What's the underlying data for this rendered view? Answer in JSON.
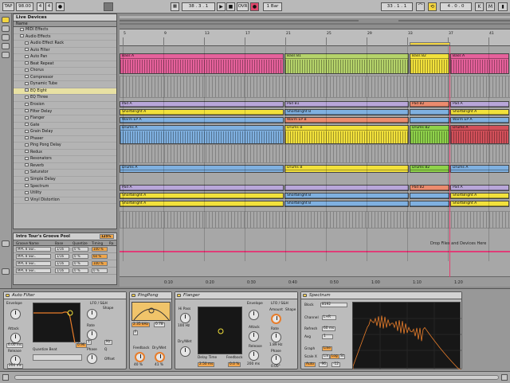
{
  "transport": {
    "tap": "TAP",
    "tempo": "98.00",
    "sig_num": "4",
    "sig_den": "4",
    "follow_icon": "metronome-icon",
    "position": "38 . 3 . 1",
    "ovr": "OVR",
    "quantize": "1 Bar",
    "loop_start": "33 . 1 . 1",
    "loop_len": "4 . 0 . 0"
  },
  "browser": {
    "title": "Live Devices",
    "column": "Name",
    "items": [
      {
        "label": "MIDI Effects",
        "depth": 1
      },
      {
        "label": "Audio Effects",
        "depth": 1
      },
      {
        "label": "Audio Effect Rack",
        "depth": 2
      },
      {
        "label": "Auto Filter",
        "depth": 2
      },
      {
        "label": "Auto Pan",
        "depth": 2
      },
      {
        "label": "Beat Repeat",
        "depth": 2
      },
      {
        "label": "Chorus",
        "depth": 2
      },
      {
        "label": "Compressor",
        "depth": 2
      },
      {
        "label": "Dynamic Tube",
        "depth": 2
      },
      {
        "label": "EQ Eight",
        "depth": 2,
        "selected": true
      },
      {
        "label": "EQ Three",
        "depth": 2
      },
      {
        "label": "Erosion",
        "depth": 2
      },
      {
        "label": "Filter Delay",
        "depth": 2
      },
      {
        "label": "Flanger",
        "depth": 2
      },
      {
        "label": "Gate",
        "depth": 2
      },
      {
        "label": "Grain Delay",
        "depth": 2
      },
      {
        "label": "Phaser",
        "depth": 2
      },
      {
        "label": "Ping Pong Delay",
        "depth": 2
      },
      {
        "label": "Redux",
        "depth": 2
      },
      {
        "label": "Resonators",
        "depth": 2
      },
      {
        "label": "Reverb",
        "depth": 2
      },
      {
        "label": "Saturator",
        "depth": 2
      },
      {
        "label": "Simple Delay",
        "depth": 2
      },
      {
        "label": "Spectrum",
        "depth": 2
      },
      {
        "label": "Utility",
        "depth": 2
      },
      {
        "label": "Vinyl Distortion",
        "depth": 2
      }
    ]
  },
  "groove": {
    "title": "Intro Tour's Groove Pool",
    "global": "125%",
    "columns": [
      "Groove Name",
      "Base",
      "Quantize",
      "Timing",
      "Ra"
    ],
    "rows": [
      {
        "name": "MPC 8 Swi..",
        "base": "1/16",
        "quantize": "0 %",
        "timing": "100 %"
      },
      {
        "name": "MPC 8 Swi..",
        "base": "1/16",
        "quantize": "0 %",
        "timing": "60 %"
      },
      {
        "name": "MPC 8 Swi..",
        "base": "1/16",
        "quantize": "0 %",
        "timing": "100 %"
      },
      {
        "name": "MPC 8 Swi..",
        "base": "1/16",
        "quantize": "0 %",
        "timing": "0 %"
      }
    ]
  },
  "arrangement": {
    "bars": [
      "5",
      "9",
      "13",
      "17",
      "21",
      "25",
      "29",
      "33",
      "37",
      "41"
    ],
    "times": [
      "0:10",
      "0:20",
      "0:30",
      "0:40",
      "0:50",
      "1:00",
      "1:10",
      "1:20"
    ],
    "drop_text": "Drop Files and Devices Here",
    "clip_colors": {
      "pink": "#e6619b",
      "green": "#b5d36a",
      "yellow": "#f2e13b",
      "blue": "#7fb0e0",
      "salmon": "#eb8b6e",
      "purple": "#b8a6d9",
      "lime": "#8fd24a",
      "red": "#d3505a"
    },
    "lanes": [
      {
        "clips": [
          {
            "label": "Bass A",
            "c": "pink"
          },
          {
            "label": "Bass B1",
            "c": "green"
          },
          {
            "label": "Bass B2",
            "c": "yellow"
          },
          {
            "label": "Bass A",
            "c": "pink"
          }
        ]
      },
      {
        "clips": [
          {
            "label": "Pad A",
            "c": "purple"
          },
          {
            "label": "Pad B1",
            "c": "purple"
          },
          {
            "label": "Pad B2",
            "c": "salmon"
          },
          {
            "label": "Pad A",
            "c": "purple"
          }
        ]
      },
      {
        "clips": [
          {
            "label": "ShortBright A",
            "c": "yellow"
          },
          {
            "label": "ShortBright B",
            "c": "blue"
          },
          {
            "label": "",
            "c": "blue"
          },
          {
            "label": "ShortBright A",
            "c": "yellow"
          }
        ]
      },
      {
        "clips": [
          {
            "label": "Warm EP A",
            "c": "blue"
          },
          {
            "label": "Warm EP B",
            "c": "salmon"
          },
          {
            "label": "",
            "c": "blue"
          },
          {
            "label": "Warm EP A",
            "c": "blue"
          }
        ]
      },
      {
        "clips": [
          {
            "label": "Drums A",
            "c": "blue"
          },
          {
            "label": "Drums B",
            "c": "yellow"
          },
          {
            "label": "Drums B2",
            "c": "lime"
          },
          {
            "label": "Drums A",
            "c": "red"
          }
        ]
      },
      {
        "clips": [
          {
            "label": "Drums A",
            "c": "blue"
          },
          {
            "label": "Drums B",
            "c": "yellow"
          },
          {
            "label": "Drums B2",
            "c": "lime"
          },
          {
            "label": "Drums A",
            "c": "blue"
          }
        ]
      },
      {
        "clips": [
          {
            "label": "Pad A",
            "c": "purple"
          },
          {
            "label": "",
            "c": "purple"
          },
          {
            "label": "Pad B2",
            "c": "salmon"
          },
          {
            "label": "Pad A",
            "c": "purple"
          }
        ]
      },
      {
        "clips": [
          {
            "label": "ShortBright A",
            "c": "yellow"
          },
          {
            "label": "ShortBright B",
            "c": "blue"
          },
          {
            "label": "",
            "c": "blue"
          },
          {
            "label": "ShortBright A",
            "c": "yellow"
          }
        ]
      },
      {
        "clips": [
          {
            "label": "ShortBright A",
            "c": "yellow"
          },
          {
            "label": "ShortBright B",
            "c": "blue"
          },
          {
            "label": "",
            "c": "blue"
          },
          {
            "label": "ShortBright A",
            "c": "yellow"
          }
        ]
      }
    ]
  },
  "devices": {
    "autofilter": {
      "title": "Auto Filter",
      "envelope": "Envelope",
      "lfo": "LFO / S&H",
      "attack": "Attack",
      "release": "Release",
      "quantize": "Quantize Beat",
      "shape": "Shape",
      "rate": "Rate",
      "phase": "Phase",
      "offset": "Offset",
      "attack_val": "6.00 ms",
      "release_val": "200 ms",
      "freq": "0.96",
      "rate_val": "1",
      "hz": "Hz",
      "q": "Q"
    },
    "pingpong": {
      "title": "PingPong",
      "freeze": "F",
      "feedback": "Feedback",
      "drywet": "Dry/Wet",
      "fb_val": "40 %",
      "dw_val": "41 %",
      "val1": "2.35 kHz",
      "val2": "0.78"
    },
    "flanger": {
      "title": "Flanger",
      "hipass": "Hi Pass",
      "hipass_val": "100 Hz",
      "delay": "Delay Time",
      "delay_val": "2.50 ms",
      "feedback": "Feedback",
      "fb_val": "0.0 %",
      "drywet": "Dry/Wet",
      "envelope": "Envelope",
      "lfo": "LFO / S&H",
      "amount": "Amount",
      "shape": "Shape",
      "attack": "Attack",
      "release": "Release",
      "rate": "Rate",
      "phase": "Phase",
      "release_val": "200 ms",
      "rate_val": "1.89 Hz",
      "phase_val": "0.00°"
    },
    "spectrum": {
      "title": "Spectrum",
      "block": "Block",
      "block_val": "8192",
      "channel": "Channel",
      "channel_val": "L+R",
      "refresh": "Refresh",
      "refresh_val": "60 ms",
      "avg": "Avg",
      "avg_val": "1",
      "graph": "Graph",
      "graph_val": "Line",
      "scalex": "Scale X",
      "lin": "Lin",
      "log": "Log",
      "st": "St",
      "auto": "Auto",
      "range1": "-96",
      "range2": "-12"
    }
  },
  "colors": {
    "accent": "#e87d2a",
    "scope_line": "#f2e13b"
  }
}
